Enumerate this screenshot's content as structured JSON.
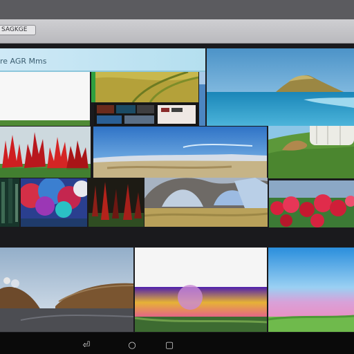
{
  "browser": {
    "tab_label": "SAGKGE"
  },
  "site": {
    "title": "re AGR Mms"
  },
  "navigation": {
    "back_glyph": "⏎",
    "home_glyph": "○",
    "recents_glyph": "▢"
  },
  "icons": {
    "back": "back-icon",
    "home": "home-icon",
    "recents": "recents-icon"
  },
  "colors": {
    "bezel": "#5b5b5f",
    "chrome": "#c8c8cb",
    "header_band": "#c2e4f2",
    "nav_bar": "#0a0a0a"
  }
}
